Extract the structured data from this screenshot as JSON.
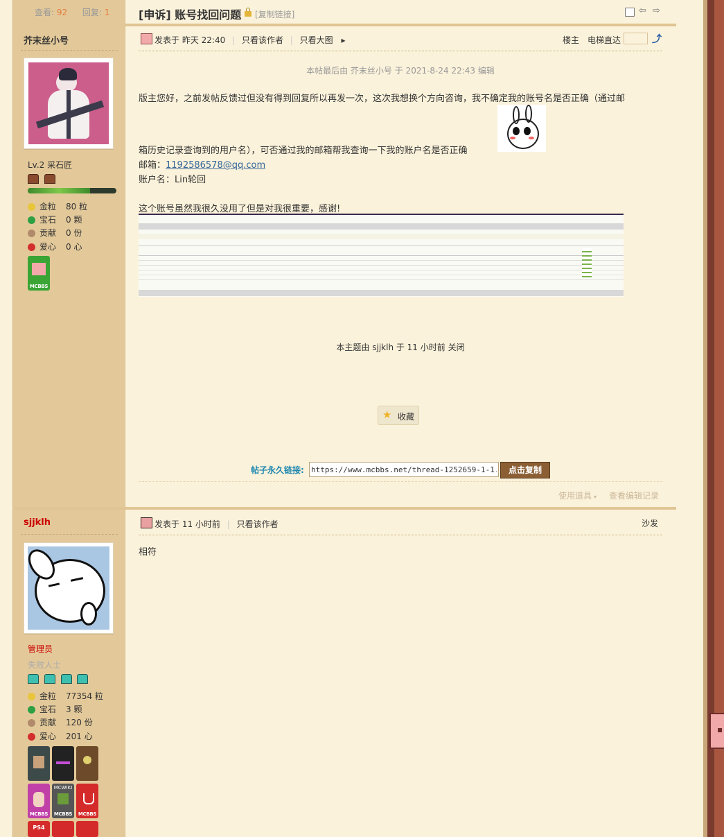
{
  "thread": {
    "views_label": "查看:",
    "views": "92",
    "replies_label": "回复:",
    "replies": "1",
    "category": "[申诉]",
    "title": "账号找回问题",
    "copy_link": "[复制链接]"
  },
  "post1": {
    "author": "芥末丝小号",
    "level": "Lv.2 采石匠",
    "stats": [
      {
        "label": "金粒",
        "value": "80 粒",
        "icon": "gold-nugget-icon",
        "color": "#e8c53a"
      },
      {
        "label": "宝石",
        "value": "0 颗",
        "icon": "emerald-icon",
        "color": "#2ea043"
      },
      {
        "label": "贡献",
        "value": "0 份",
        "icon": "contribution-icon",
        "color": "#b08a6a"
      },
      {
        "label": "爱心",
        "value": "0 心",
        "icon": "apple-heart-icon",
        "color": "#d32f2f"
      }
    ],
    "posted_prefix": "发表于",
    "posted_time": "昨天 22:40",
    "only_author": "只看该作者",
    "only_big_image": "只看大图",
    "floor": "楼主",
    "elevator": "电梯直达",
    "edit_note": "本帖最后由 芥末丝小号 于 2021-8-24 22:43 编辑",
    "body_line1": "版主您好，之前发帖反馈过但没有得到回复所以再发一次，这次我想换个方向咨询，我不确定我的账号名是否正确（通过邮",
    "body_line2": "箱历史记录查询到的用户名），可否通过我的邮箱帮我查询一下我的账户名是否正确",
    "email_label": "邮箱：",
    "email": "1192586578@qq.com",
    "account_label": "账户名：",
    "account": "Lin轮回",
    "body_line3": "这个账号虽然我很久没用了但是对我很重要，感谢!",
    "closed_note": "本主题由 sjjklh 于 11 小时前 关闭",
    "favorite": "收藏",
    "permalink_label": "帖子永久链接:",
    "permalink": "https://www.mcbbs.net/thread-1252659-1-1.html",
    "copy_button": "点击复制",
    "use_tools": "使用道具",
    "view_edit_log": "查看编辑记录"
  },
  "post2": {
    "author": "sjjklh",
    "role": "管理员",
    "title": "失败人士",
    "stats": [
      {
        "label": "金粒",
        "value": "77354 粒",
        "icon": "gold-nugget-icon",
        "color": "#e8c53a"
      },
      {
        "label": "宝石",
        "value": "3 颗",
        "icon": "emerald-icon",
        "color": "#2ea043"
      },
      {
        "label": "贡献",
        "value": "120 份",
        "icon": "contribution-icon",
        "color": "#b08a6a"
      },
      {
        "label": "爱心",
        "value": "201 心",
        "icon": "apple-heart-icon",
        "color": "#d32f2f"
      }
    ],
    "posted_prefix": "发表于",
    "posted_time": "11 小时前",
    "only_author": "只看该作者",
    "floor": "沙发",
    "body": "相符"
  },
  "medals": {
    "tag": "MCBBS",
    "wiki": "MCWIKI",
    "ps4": "PS4"
  },
  "colors": {
    "accent_link": "#336699",
    "admin_red": "#cc0000",
    "permalink_blue": "#1e88b0"
  }
}
